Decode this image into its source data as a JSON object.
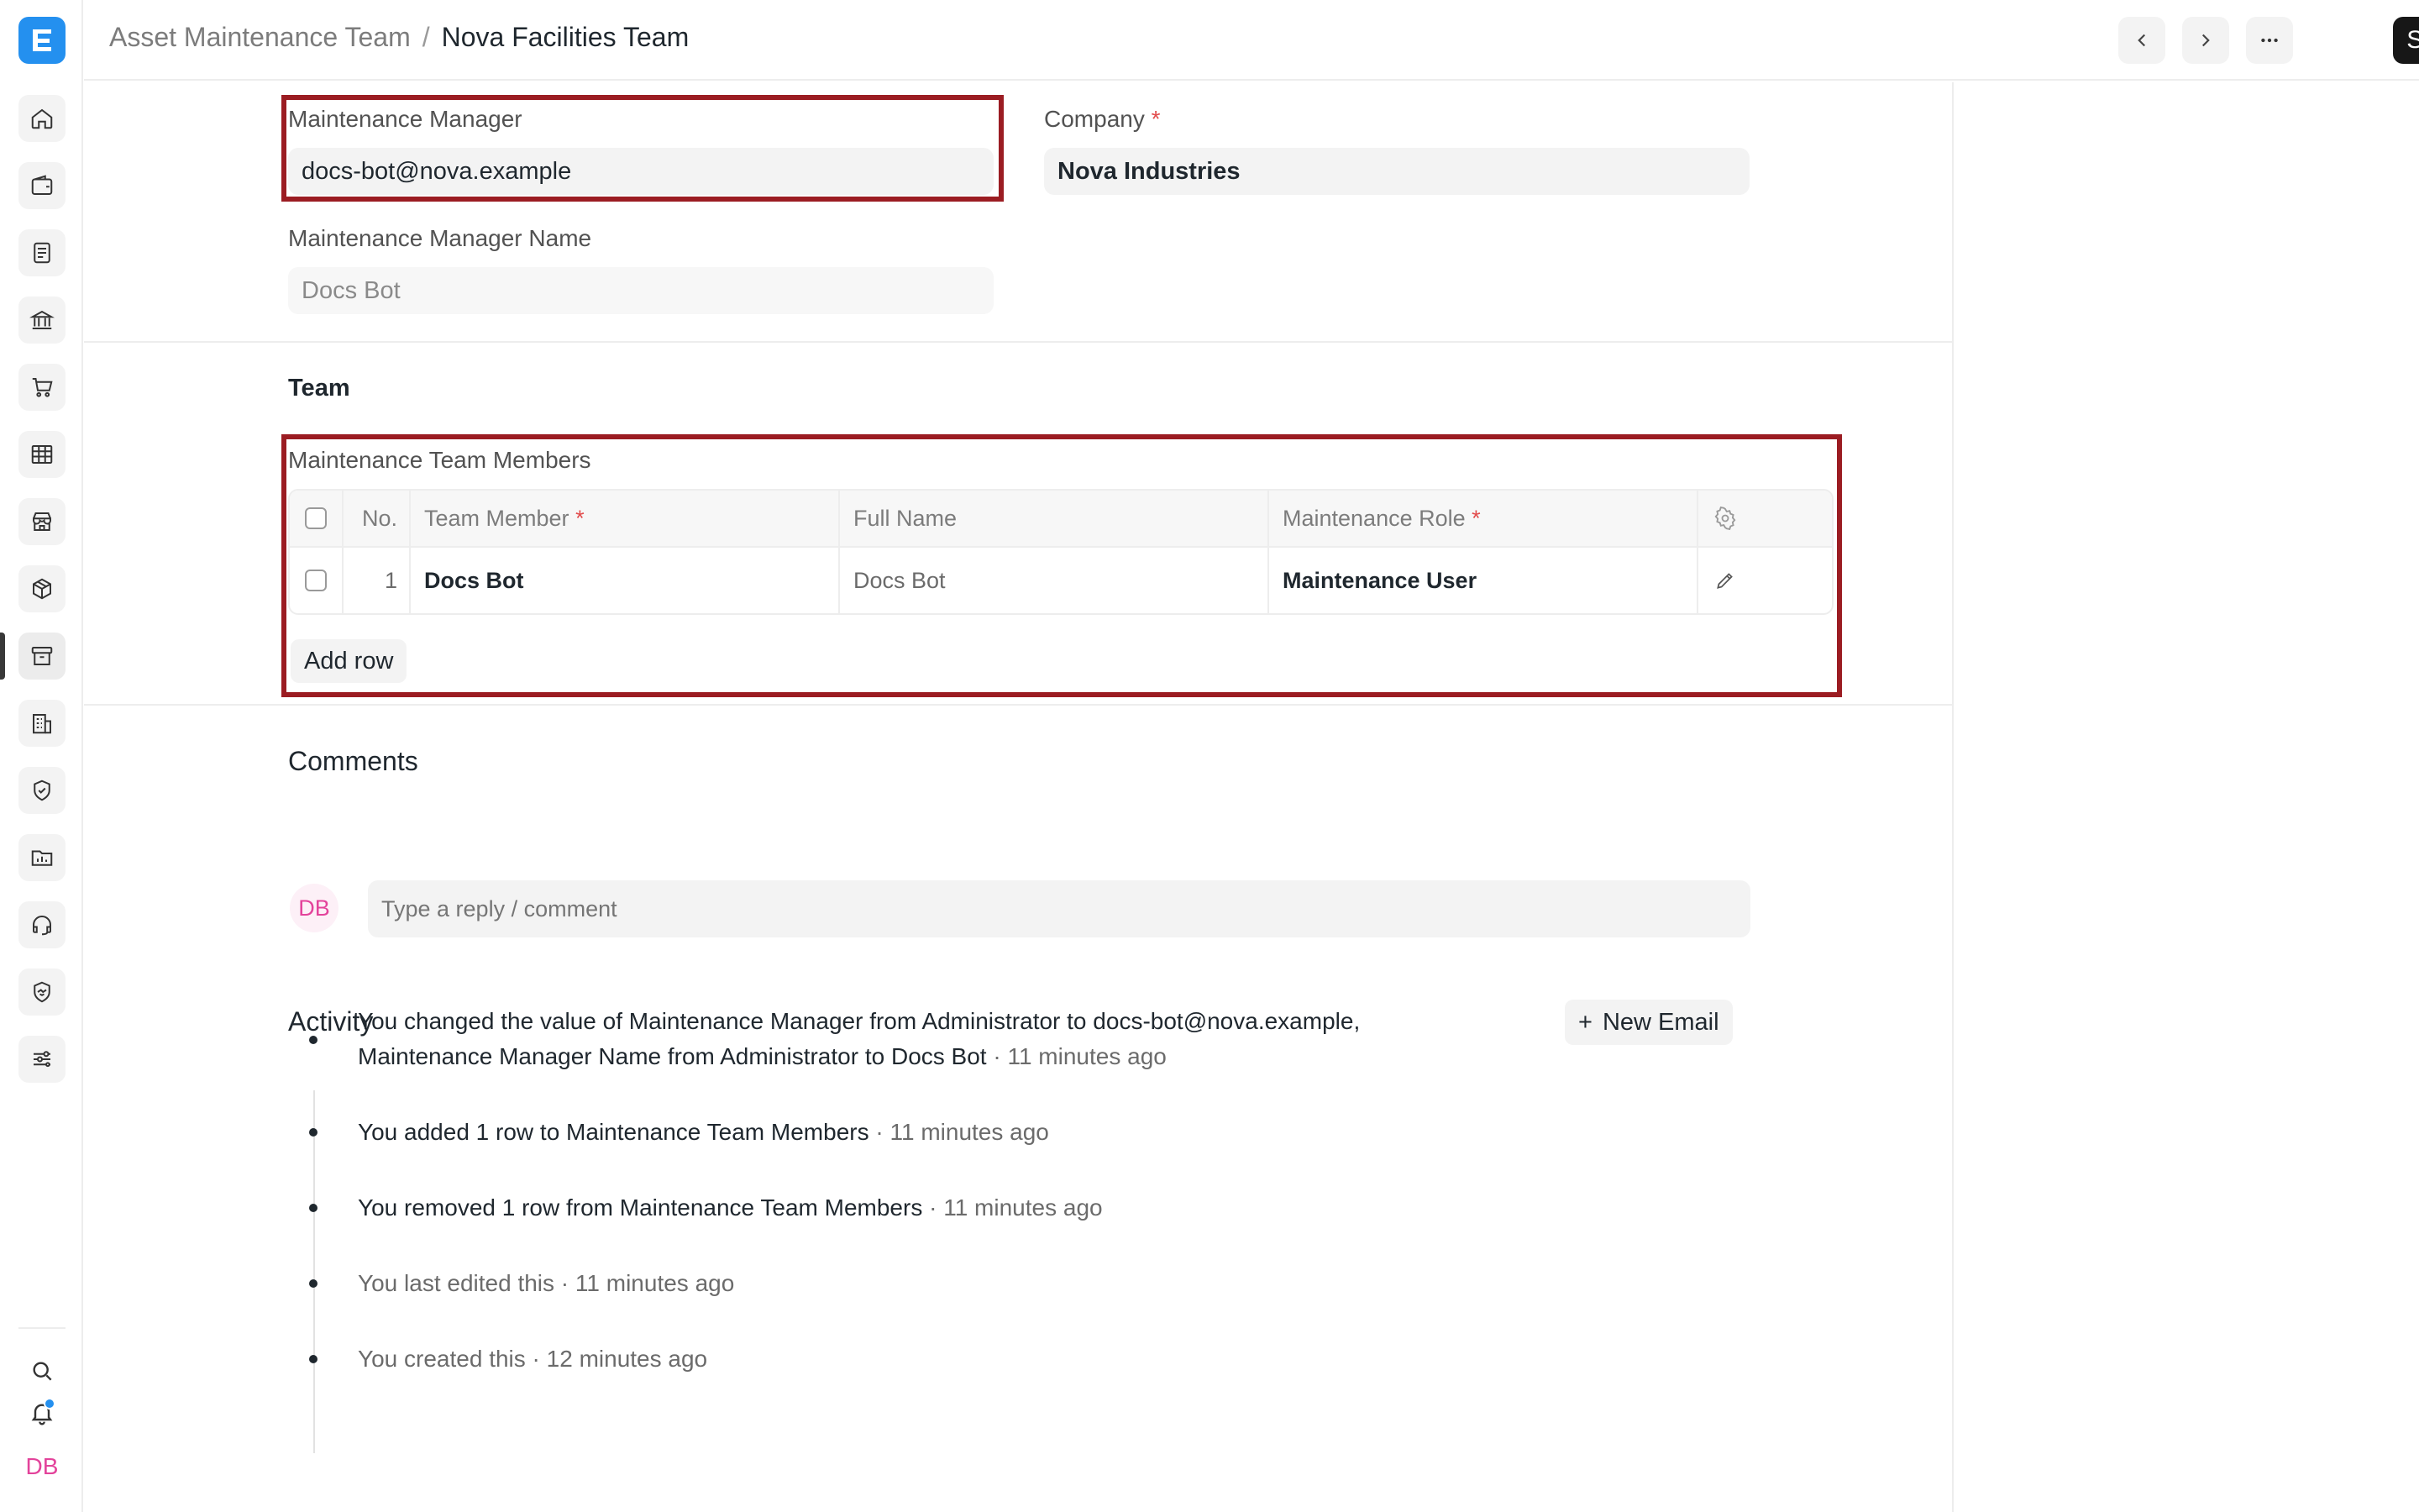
{
  "header": {
    "breadcrumb_parent": "Asset Maintenance Team",
    "breadcrumb_sep": "/",
    "breadcrumb_current": "Nova Facilities Team",
    "save_label": "Save"
  },
  "form": {
    "maintenance_manager": {
      "label": "Maintenance Manager",
      "value": "docs-bot@nova.example"
    },
    "company": {
      "label": "Company",
      "required_mark": "*",
      "value": "Nova Industries"
    },
    "maintenance_manager_name": {
      "label": "Maintenance Manager Name",
      "value": "Docs Bot"
    }
  },
  "team_section": {
    "title": "Team",
    "table_label": "Maintenance Team Members",
    "columns": {
      "no": "No.",
      "team_member": "Team Member",
      "full_name": "Full Name",
      "maintenance_role": "Maintenance Role",
      "required_mark": "*"
    },
    "rows": [
      {
        "no": "1",
        "team_member": "Docs Bot",
        "full_name": "Docs Bot",
        "maintenance_role": "Maintenance User"
      }
    ],
    "add_row_label": "Add row"
  },
  "comments": {
    "title": "Comments",
    "avatar_initials": "DB",
    "placeholder": "Type a reply / comment"
  },
  "activity": {
    "title": "Activity",
    "new_email_label": "New Email",
    "new_email_plus": "+",
    "items": [
      {
        "p1": "You changed the value of Maintenance Manager from ",
        "b1": "Administrator",
        "p2": " to ",
        "b2": "docs-bot@nova.example",
        "p3": ",",
        "p4": "Maintenance Manager Name from ",
        "b3": "Administrator",
        "p5": " to ",
        "b4": "Docs Bot",
        "time": " · 11 minutes ago"
      },
      {
        "text": "You added 1 row to Maintenance Team Members",
        "time": " · 11 minutes ago"
      },
      {
        "text": "You removed 1 row from Maintenance Team Members",
        "time": " · 11 minutes ago"
      },
      {
        "text": "You last edited this · 11 minutes ago"
      },
      {
        "text": "You created this · 12 minutes ago"
      }
    ]
  },
  "sidebar": {
    "user_initials": "DB",
    "icons": [
      "home-icon",
      "wallet-icon",
      "document-icon",
      "bank-icon",
      "cart-icon",
      "table-icon",
      "store-icon",
      "package-icon",
      "archive-icon",
      "building-icon",
      "shield-icon",
      "folder-chart-icon",
      "headset-icon",
      "handshake-icon",
      "sliders-icon"
    ]
  },
  "colors": {
    "brand": "#2490ef",
    "highlight_border": "#9b1c22",
    "avatar": "#e3439b",
    "save_button": "#171717"
  }
}
